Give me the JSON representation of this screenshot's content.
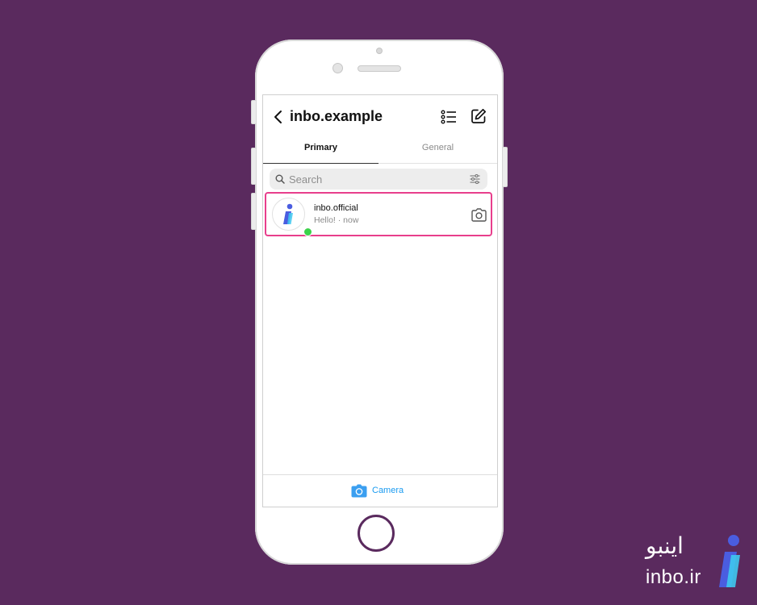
{
  "header": {
    "title": "inbo.example",
    "back_icon": "chevron-left-icon",
    "list_icon": "list-icon",
    "edit_icon": "edit-icon"
  },
  "tabs": [
    {
      "label": "Primary",
      "selected": true
    },
    {
      "label": "General",
      "selected": false
    }
  ],
  "search": {
    "placeholder": "Search",
    "value": "",
    "icon": "search-icon",
    "filter_icon": "filter-icon"
  },
  "chats": [
    {
      "name": "inbo.official",
      "preview": "Hello! · now",
      "online": true,
      "highlighted": true,
      "camera_icon": "camera-icon"
    }
  ],
  "bottom_bar": {
    "camera_label": "Camera",
    "camera_icon": "camera-icon"
  },
  "brand": {
    "name_fa": "اینبو",
    "domain": "inbo.ir"
  },
  "colors": {
    "background": "#5a2a5e",
    "highlight": "#e83e8c",
    "accent_blue": "#1a9bf0",
    "online_green": "#3cd24a"
  }
}
